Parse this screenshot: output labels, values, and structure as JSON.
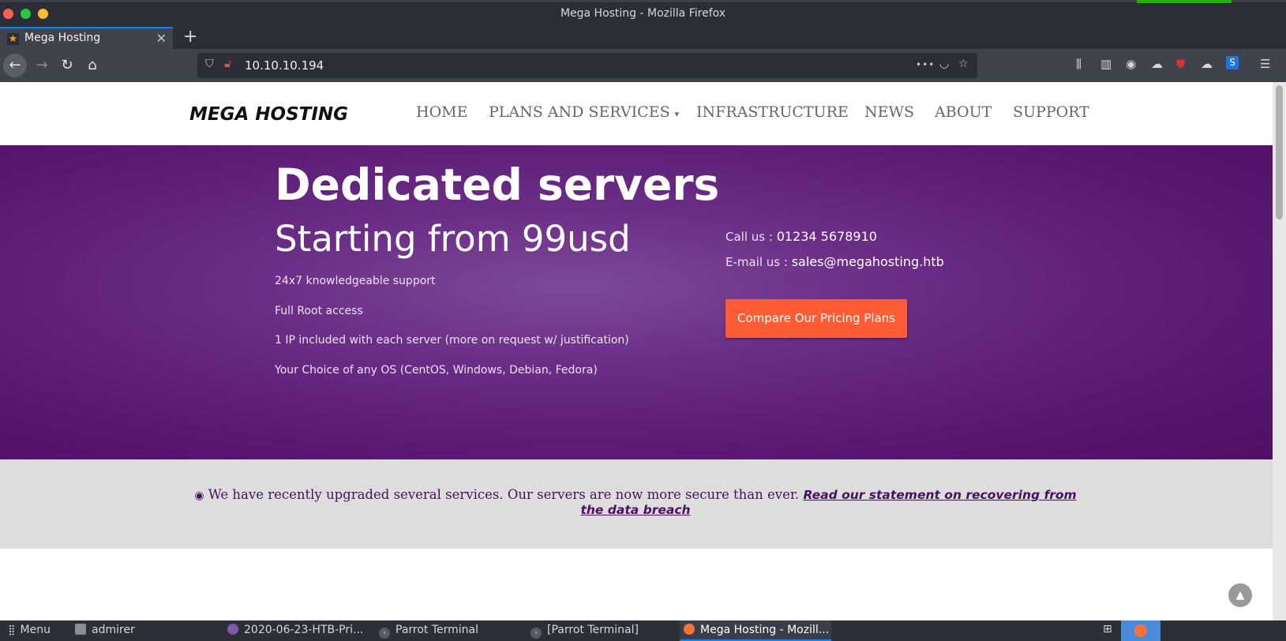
{
  "window": {
    "title": "Mega Hosting - Mozilla Firefox",
    "close_color": "#ff5f57",
    "maximize_color": "#28c840",
    "minimize_color": "#febc2e"
  },
  "tab": {
    "label": "Mega Hosting",
    "close_glyph": "✕",
    "new_tab_glyph": "+"
  },
  "navbar": {
    "back_glyph": "←",
    "forward_glyph": "→",
    "reload_glyph": "↻",
    "home_glyph": "⌂",
    "url": "10.10.10.194",
    "url_more_glyph": "•••",
    "menu_glyph": "☰"
  },
  "site": {
    "logo": "MEGA HOSTING",
    "menu": {
      "home": "HOME",
      "plans": "PLANS AND SERVICES",
      "plans_caret": "▾",
      "infrastructure": "INFRASTRUCTURE",
      "news": "NEWS",
      "about": "ABOUT",
      "support": "SUPPORT"
    },
    "hero": {
      "title": "Dedicated servers",
      "subtitle": "Starting from 99usd",
      "features": [
        "24x7 knowledgeable support",
        "Full Root access",
        "1 IP included with each server (more on request w/ justification)",
        "Your Choice of any OS (CentOS, Windows, Debian, Fedora)"
      ],
      "call_label": "Call us : ",
      "call_value": "01234 5678910",
      "email_label": "E-mail us : ",
      "email_value": "sales@megahosting.htb",
      "cta": "Compare Our Pricing Plans"
    },
    "notice": {
      "text": "We have recently upgraded several services. Our servers are now more secure than ever.",
      "link": "Read our statement on recovering from the data breach"
    },
    "to_top_glyph": "▲"
  },
  "taskbar": {
    "menu": "Menu",
    "items": [
      "admirer",
      "2020-06-23-HTB-Pri...",
      "Parrot Terminal",
      "[Parrot Terminal]",
      "Mega Hosting - Mozill..."
    ]
  },
  "colors": {
    "hero_purple": "#6c2f88",
    "cta_orange": "#ff5b35",
    "notice_text": "#4a1060"
  }
}
